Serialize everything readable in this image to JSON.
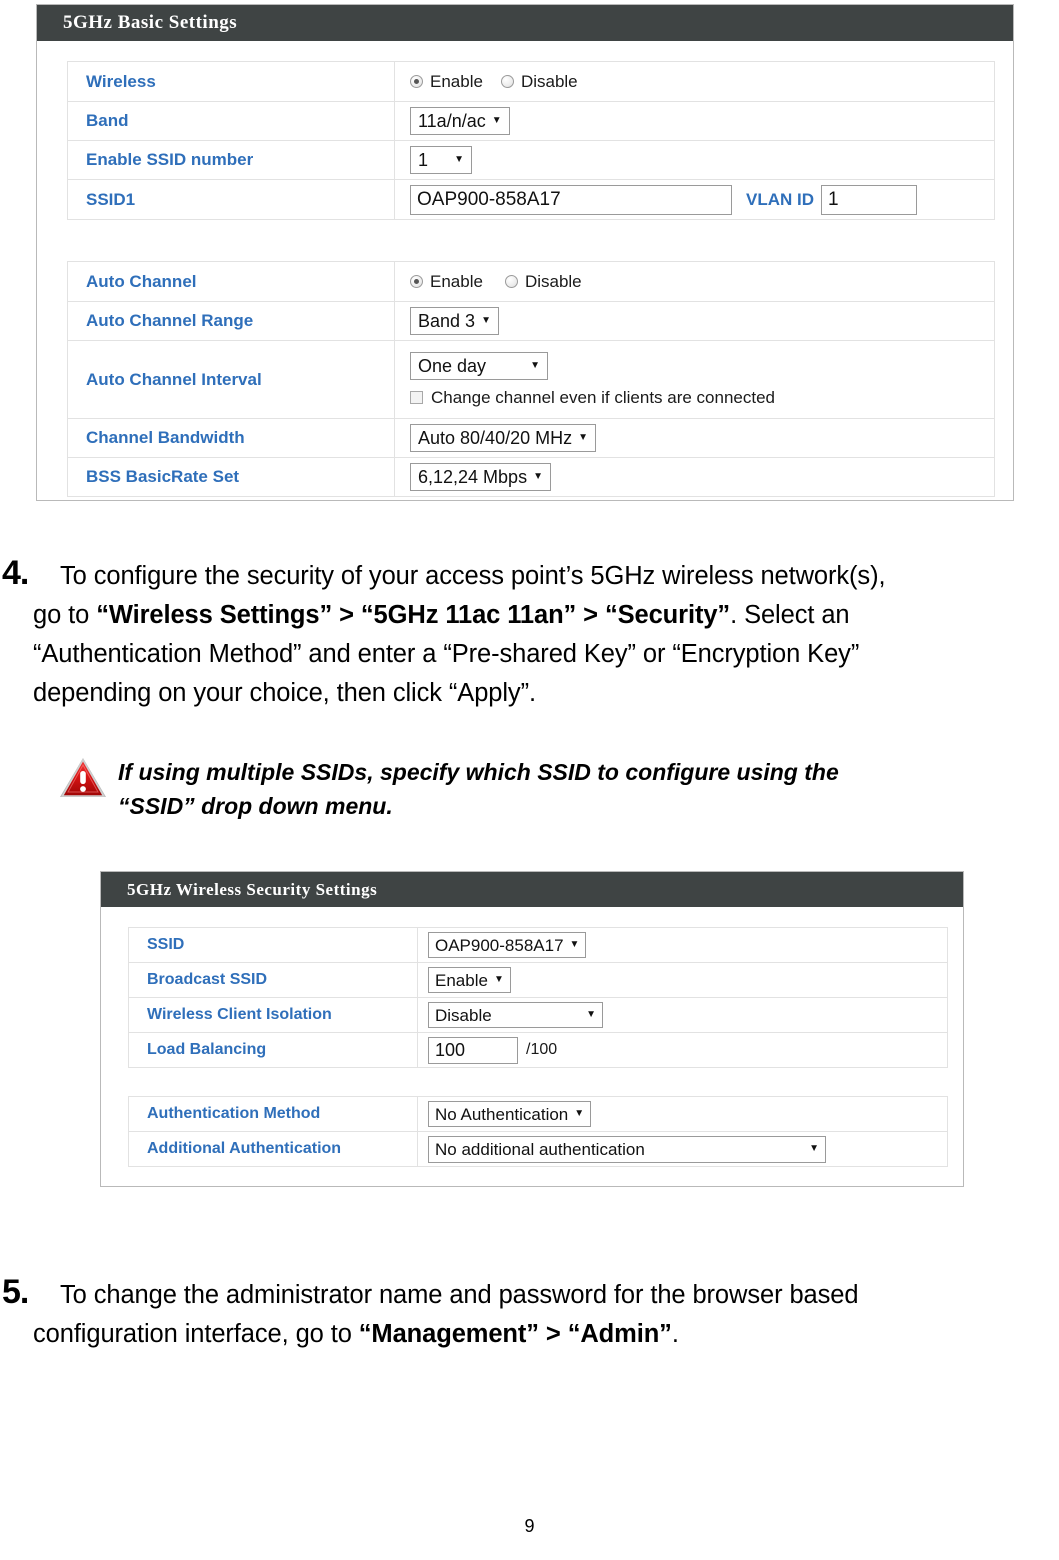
{
  "page": {
    "number": "9"
  },
  "panel_basic": {
    "title": "5GHz Basic Settings",
    "group1": [
      {
        "label": "Wireless",
        "control": "radio",
        "options": [
          "Enable",
          "Disable"
        ],
        "selected": "Enable"
      },
      {
        "label": "Band",
        "control": "select",
        "value": "11a/n/ac"
      },
      {
        "label": "Enable SSID number",
        "control": "select",
        "value": "1"
      },
      {
        "label": "SSID1",
        "control": "text-vlan",
        "value": "OAP900-858A17",
        "vlan_label": "VLAN ID",
        "vlan_value": "1"
      }
    ],
    "group2": [
      {
        "label": "Auto Channel",
        "control": "radio",
        "options": [
          "Enable",
          "Disable"
        ],
        "selected": "Enable"
      },
      {
        "label": "Auto Channel Range",
        "control": "select",
        "value": "Band 3"
      },
      {
        "label": "Auto Channel Interval",
        "control": "select-check",
        "value": "One day",
        "checkbox_label": "Change channel even if clients are connected",
        "checked": false
      },
      {
        "label": "Channel Bandwidth",
        "control": "select",
        "value": "Auto 80/40/20 MHz"
      },
      {
        "label": "BSS BasicRate Set",
        "control": "select",
        "value": "6,12,24 Mbps"
      }
    ]
  },
  "panel_security": {
    "title": "5GHz Wireless Security Settings",
    "group1": [
      {
        "label": "SSID",
        "control": "select",
        "value": "OAP900-858A17"
      },
      {
        "label": "Broadcast SSID",
        "control": "select",
        "value": "Enable"
      },
      {
        "label": "Wireless Client Isolation",
        "control": "select",
        "value": "Disable"
      },
      {
        "label": "Load Balancing",
        "control": "text-suffix",
        "value": "100",
        "suffix": "/100"
      }
    ],
    "group2": [
      {
        "label": "Authentication Method",
        "control": "select",
        "value": "No Authentication"
      },
      {
        "label": "Additional Authentication",
        "control": "select",
        "value": "No additional authentication"
      }
    ]
  },
  "steps": [
    {
      "number": "4.",
      "line1_a": "To configure the security of your access point’s 5GHz wireless network(s),",
      "line2_a": "go to ",
      "line2_b": "“Wireless Settings” > “5GHz 11ac 11an” > “Security”",
      "line2_c": ". Select an",
      "line3_a": "“Authentication Method” and enter a “Pre-shared Key” or “Encryption Key”",
      "line4_a": "depending on your choice, then click “Apply”."
    },
    {
      "number": "5.",
      "line1_a": "To change the administrator name and password for the browser based",
      "line2_a": "configuration interface, go to ",
      "line2_b": "“Management” > “Admin”",
      "line2_c": "."
    }
  ],
  "note": {
    "icon": "warning-triangle-icon",
    "line1": "If using multiple SSIDs, specify which SSID to configure using the",
    "line2": "“SSID” drop down menu."
  },
  "colors": {
    "header_bar": "#3f4444",
    "label_blue": "#2f6fba",
    "panel_border": "#b9b9b9",
    "warning_red": "#cc1414"
  }
}
